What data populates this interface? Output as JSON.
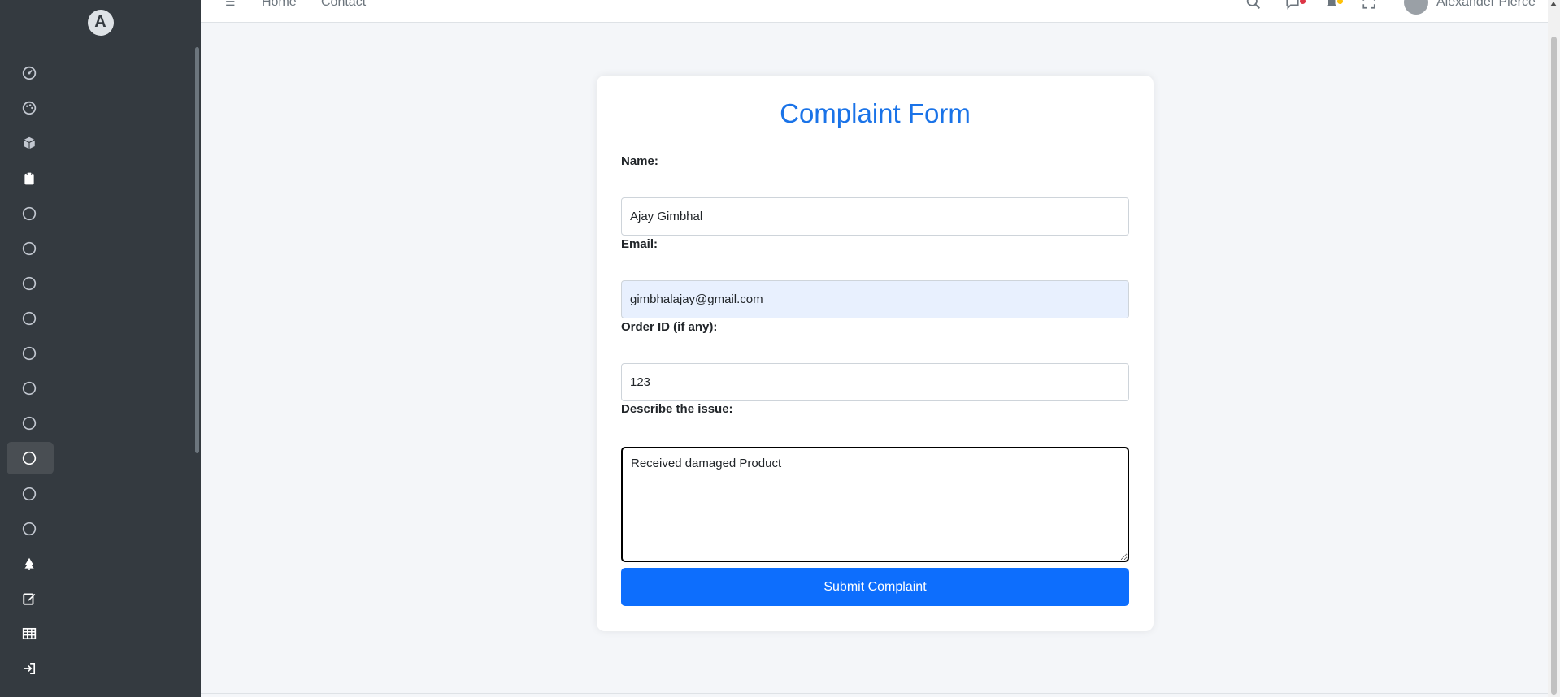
{
  "topbar": {
    "nav_links": [
      "Home",
      "Contact"
    ],
    "user_name": "Alexander Pierce",
    "icons": [
      "menu-icon",
      "search-icon",
      "chat-icon",
      "bell-icon",
      "expand-icon"
    ]
  },
  "sidebar": {
    "brand_letter": "A",
    "items": [
      {
        "icon": "dashboard-icon"
      },
      {
        "icon": "palette-icon"
      },
      {
        "icon": "box-icon"
      },
      {
        "icon": "clipboard-icon"
      },
      {
        "icon": "circle-icon"
      },
      {
        "icon": "circle-icon"
      },
      {
        "icon": "circle-icon"
      },
      {
        "icon": "circle-icon"
      },
      {
        "icon": "circle-icon"
      },
      {
        "icon": "circle-icon"
      },
      {
        "icon": "circle-icon"
      },
      {
        "icon": "circle-icon",
        "active": true
      },
      {
        "icon": "circle-icon"
      },
      {
        "icon": "circle-icon"
      },
      {
        "icon": "tree-icon"
      },
      {
        "icon": "edit-icon"
      },
      {
        "icon": "table-icon"
      },
      {
        "icon": "sign-in-icon"
      }
    ]
  },
  "form": {
    "title": "Complaint Form",
    "name_label": "Name:",
    "name_value": "Ajay Gimbhal",
    "email_label": "Email:",
    "email_value": "gimbhalajay@gmail.com",
    "order_label": "Order ID (if any):",
    "order_value": "123",
    "issue_label": "Describe the issue:",
    "issue_value": "Received damaged Product",
    "submit_label": "Submit Complaint"
  },
  "colors": {
    "sidebar_bg": "#343a40",
    "accent": "#0d6efd",
    "title": "#1a73e8",
    "page_bg": "#f4f6f9"
  }
}
